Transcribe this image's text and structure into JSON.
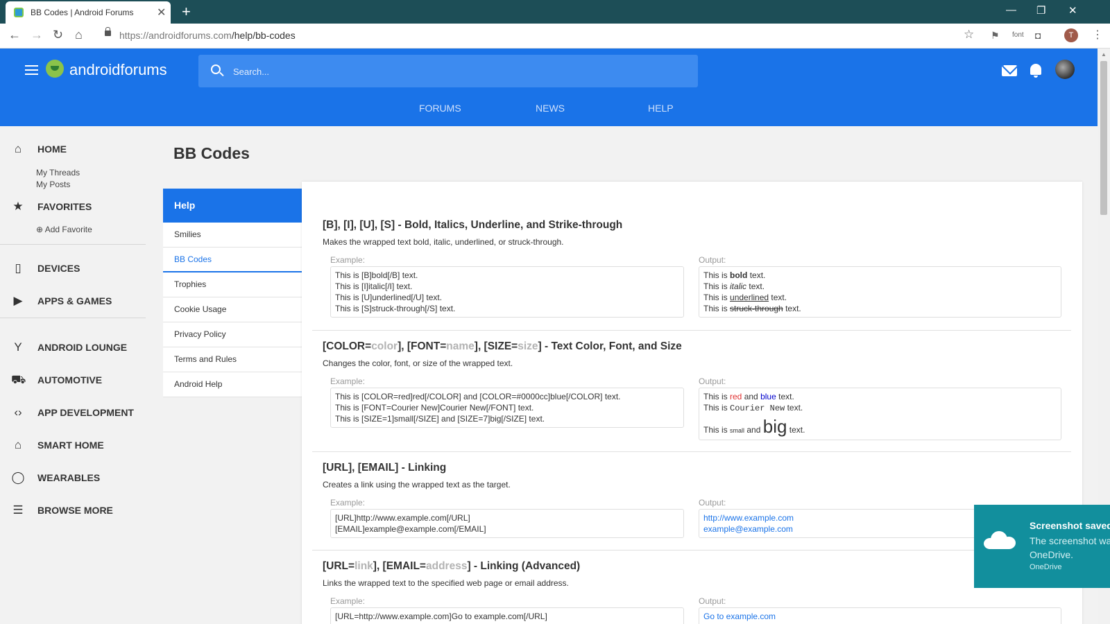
{
  "browser": {
    "tab_title": "BB Codes | Android Forums",
    "url_host": "https://androidforums.com",
    "url_path": "/help/bb-codes",
    "ext_font_label": "font",
    "profile_initial": "T"
  },
  "header": {
    "logo_part1": "android",
    "logo_part2": "forums",
    "search_placeholder": "Search...",
    "nav": [
      "FORUMS",
      "NEWS",
      "HELP"
    ]
  },
  "sidebar": {
    "home": "HOME",
    "my_threads": "My Threads",
    "my_posts": "My Posts",
    "favorites": "FAVORITES",
    "add_favorite": "Add Favorite",
    "items": [
      {
        "label": "DEVICES",
        "icon": "phone-icon"
      },
      {
        "label": "APPS & GAMES",
        "icon": "play-store-icon"
      },
      {
        "label": "ANDROID LOUNGE",
        "icon": "cocktail-icon"
      },
      {
        "label": "AUTOMOTIVE",
        "icon": "car-icon"
      },
      {
        "label": "APP DEVELOPMENT",
        "icon": "code-icon"
      },
      {
        "label": "SMART HOME",
        "icon": "home-icon"
      },
      {
        "label": "WEARABLES",
        "icon": "watch-icon"
      },
      {
        "label": "BROWSE MORE",
        "icon": "list-icon"
      }
    ]
  },
  "page": {
    "title": "BB Codes"
  },
  "helpnav": {
    "heading": "Help",
    "items": [
      "Smilies",
      "BB Codes",
      "Trophies",
      "Cookie Usage",
      "Privacy Policy",
      "Terms and Rules",
      "Android Help"
    ],
    "active": "BB Codes"
  },
  "labels": {
    "example": "Example:",
    "output": "Output:"
  },
  "sections": {
    "s1": {
      "title": "[B], [I], [U], [S] - Bold, Italics, Underline, and Strike-through",
      "desc": "Makes the wrapped text bold, italic, underlined, or struck-through.",
      "example": [
        "This is [B]bold[/B] text.",
        "This is [I]italic[/I] text.",
        "This is [U]underlined[/U] text.",
        "This is [S]struck-through[/S] text."
      ],
      "out_prefix": "This is",
      "out_suffix": "text.",
      "out_words": [
        "bold",
        "italic",
        "underlined",
        "struck-through"
      ]
    },
    "s2": {
      "title_a": "[COLOR=",
      "title_ph1": "color",
      "title_b": "], [FONT=",
      "title_ph2": "name",
      "title_c": "], [SIZE=",
      "title_ph3": "size",
      "title_d": "] - Text Color, Font, and Size",
      "desc": "Changes the color, font, or size of the wrapped text.",
      "example": [
        "This is [COLOR=red]red[/COLOR] and [COLOR=#0000cc]blue[/COLOR] text.",
        "This is [FONT=Courier New]Courier New[/FONT] text.",
        "This is [SIZE=1]small[/SIZE] and [SIZE=7]big[/SIZE] text."
      ],
      "out_prefix": "This is",
      "out_and": "and",
      "out_suffix": "text.",
      "red": "red",
      "blue": "blue",
      "courier": "Courier New",
      "small": "small",
      "big": "big",
      "red_color": "#e03030",
      "blue_color": "#0000cc"
    },
    "s3": {
      "title": "[URL], [EMAIL] - Linking",
      "desc": "Creates a link using the wrapped text as the target.",
      "example": [
        "[URL]http://www.example.com[/URL]",
        "[EMAIL]example@example.com[/EMAIL]"
      ],
      "output": [
        "http://www.example.com",
        "example@example.com"
      ]
    },
    "s4": {
      "title_a": "[URL=",
      "title_ph1": "link",
      "title_b": "], [EMAIL=",
      "title_ph2": "address",
      "title_c": "] - Linking (Advanced)",
      "desc": "Links the wrapped text to the specified web page or email address.",
      "example": [
        "[URL=http://www.example.com]Go to example.com[/URL]"
      ],
      "output": [
        "Go to example.com"
      ]
    }
  },
  "toast": {
    "title": "Screenshot saved",
    "body1": "The screenshot was added to your",
    "body2": "OneDrive.",
    "app": "OneDrive"
  },
  "colors": {
    "brand": "#1a73e8",
    "chrome_tabbar": "#1d4e57",
    "toast_bg": "#128f9d"
  }
}
